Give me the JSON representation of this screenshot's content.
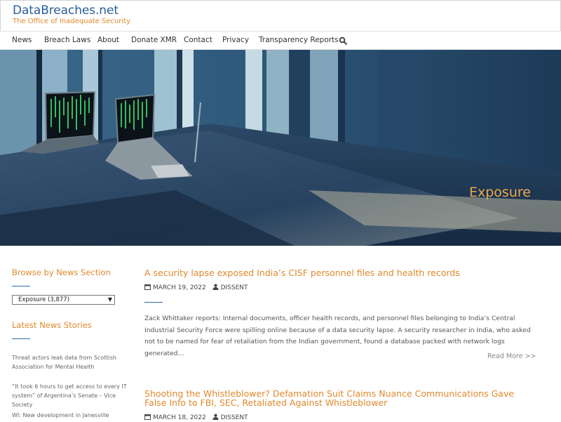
{
  "site": {
    "title": "DataBreaches.net",
    "tagline": "The Office of Inadequate Security"
  },
  "nav": {
    "items": [
      "News",
      "Breach Laws",
      "About",
      "Donate XMR",
      "Contact",
      "Privacy",
      "Transparency Reports"
    ],
    "search_icon": "search-icon"
  },
  "hero": {
    "title": "Exposure"
  },
  "sidebar": {
    "section_heading": "Browse by News Section",
    "select_value": "Exposure  (3,877)",
    "latest_heading": "Latest News Stories",
    "stories": [
      "Threat actors leak data from Scottish Association for Mental Health",
      "“It took 6 hours to get access to every IT system” of Argentina’s Senate – Vice Society",
      "WI: New development in Janesville school"
    ]
  },
  "posts": [
    {
      "title": "A security lapse exposed India’s CISF personnel files and health records",
      "date": "MARCH 19, 2022",
      "author": "DISSENT",
      "excerpt": "Zack Whittaker reports: Internal documents, officer health records, and personnel files belonging to India’s Central Industrial Security Force were spilling online because of a data security lapse. A security researcher in India, who asked not to be named for fear of retaliation from the Indian government, found a database packed with network logs generated…",
      "read_more": "Read More >>"
    },
    {
      "title": "Shooting the Whistleblower? Defamation Suit Claims Nuance Communications Gave False Info to FBI, SEC, Retaliated Against Whistleblower",
      "date": "MARCH 18, 2022",
      "author": "DISSENT"
    }
  ],
  "colors": {
    "brand_blue": "#2a5d96",
    "accent_orange": "#e0892c",
    "hero_title": "#f0a84a"
  }
}
